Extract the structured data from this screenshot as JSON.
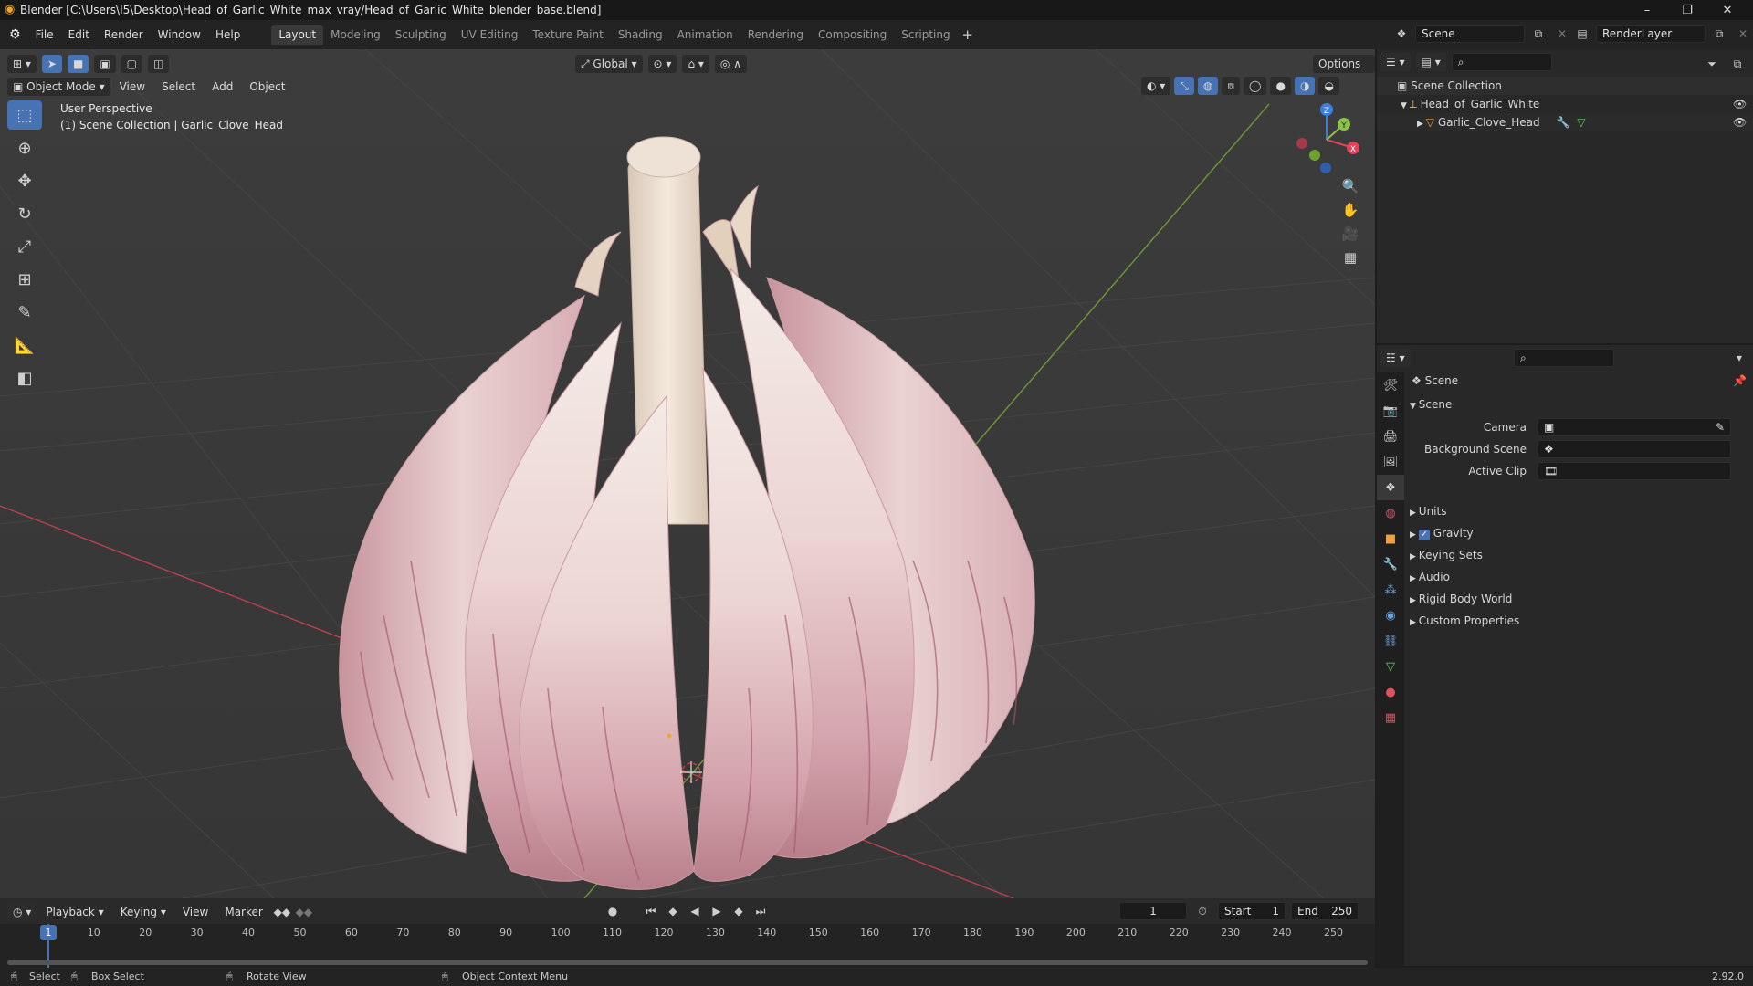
{
  "window": {
    "title": "Blender [C:\\Users\\I5\\Desktop\\Head_of_Garlic_White_max_vray/Head_of_Garlic_White_blender_base.blend]",
    "controls": [
      "–",
      "❐",
      "✕"
    ]
  },
  "menu": [
    "File",
    "Edit",
    "Render",
    "Window",
    "Help"
  ],
  "workspaces": [
    "Layout",
    "Modeling",
    "Sculpting",
    "UV Editing",
    "Texture Paint",
    "Shading",
    "Animation",
    "Rendering",
    "Compositing",
    "Scripting"
  ],
  "active_workspace": "Layout",
  "scene_field": "Scene",
  "view_layer_field": "RenderLayer",
  "header": {
    "transform_orientation": "Global",
    "options": "Options",
    "mode": "Object Mode",
    "view_menus": [
      "View",
      "Select",
      "Add",
      "Object"
    ]
  },
  "viewport": {
    "overlay_line1": "User Perspective",
    "overlay_line2": "(1) Scene Collection | Garlic_Clove_Head",
    "gizmo": {
      "x": "X",
      "y": "Y",
      "z": "Z"
    }
  },
  "outliner": {
    "root": "Scene Collection",
    "items": [
      {
        "label": "Head_of_Garlic_White"
      },
      {
        "label": "Garlic_Clove_Head"
      }
    ]
  },
  "properties": {
    "header": "Scene",
    "panel": "Scene",
    "fields": [
      {
        "label": "Camera",
        "value": ""
      },
      {
        "label": "Background Scene",
        "value": ""
      },
      {
        "label": "Active Clip",
        "value": ""
      }
    ],
    "sections": [
      "Units",
      "Gravity",
      "Keying Sets",
      "Audio",
      "Rigid Body World",
      "Custom Properties"
    ],
    "gravity_checked": true
  },
  "timeline": {
    "menus": [
      "Playback",
      "Keying",
      "View",
      "Marker"
    ],
    "current_frame": "1",
    "start_label": "Start",
    "start": "1",
    "end_label": "End",
    "end": "250",
    "ruler": [
      "1",
      "10",
      "20",
      "30",
      "40",
      "50",
      "60",
      "70",
      "80",
      "90",
      "100",
      "110",
      "120",
      "130",
      "140",
      "150",
      "160",
      "170",
      "180",
      "190",
      "200",
      "210",
      "220",
      "230",
      "240",
      "250"
    ]
  },
  "status": {
    "select": "Select",
    "box_select": "Box Select",
    "rotate_view": "Rotate View",
    "context_menu": "Object Context Menu",
    "version": "2.92.0"
  },
  "colors": {
    "accent": "#4772b3",
    "x_axis": "#e0445a",
    "y_axis": "#8bc34a",
    "z_axis": "#3d7ee0",
    "garlic_light": "#f2e6e0",
    "garlic_pink": "#c98c98"
  }
}
